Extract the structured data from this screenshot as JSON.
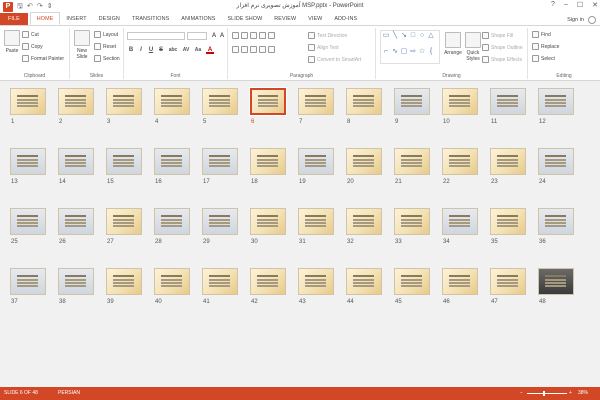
{
  "window": {
    "title": "آموزش تصویری نرم افزار MSP.pptx - PowerPoint",
    "help": "?",
    "min": "–",
    "max": "☐",
    "close": "✕"
  },
  "qat": {
    "app_icon": "P",
    "save": "🖫",
    "undo": "↶",
    "redo": "↷",
    "customize": "⇕"
  },
  "tabs": [
    "FILE",
    "HOME",
    "INSERT",
    "DESIGN",
    "TRANSITIONS",
    "ANIMATIONS",
    "SLIDE SHOW",
    "REVIEW",
    "VIEW",
    "ADD-INS"
  ],
  "active_tab": "HOME",
  "account": {
    "sign_in": "Sign in"
  },
  "ribbon": {
    "clipboard": {
      "label": "Clipboard",
      "paste": "Paste",
      "cut": "Cut",
      "copy": "Copy",
      "format_painter": "Format Painter"
    },
    "slides": {
      "label": "Slides",
      "new_slide": "New Slide",
      "layout": "Layout",
      "reset": "Reset",
      "section": "Section"
    },
    "font": {
      "label": "Font",
      "bold": "B",
      "italic": "I",
      "underline": "U",
      "strike": "S",
      "shadow": "abc",
      "spacing": "AV",
      "case": "Aa",
      "color": "A"
    },
    "paragraph": {
      "label": "Paragraph",
      "text_direction": "Text Direction",
      "align_text": "Align Text",
      "convert_smartart": "Convert to SmartArt"
    },
    "drawing": {
      "label": "Drawing",
      "arrange": "Arrange",
      "quick_styles": "Quick Styles",
      "shape_fill": "Shape Fill",
      "shape_outline": "Shape Outline",
      "shape_effects": "Shape Effects"
    },
    "editing": {
      "label": "Editing",
      "find": "Find",
      "replace": "Replace",
      "select": "Select"
    }
  },
  "slides": [
    {
      "n": "1",
      "kind": "text"
    },
    {
      "n": "2",
      "kind": "text"
    },
    {
      "n": "3",
      "kind": "text"
    },
    {
      "n": "4",
      "kind": "text"
    },
    {
      "n": "5",
      "kind": "text"
    },
    {
      "n": "6",
      "kind": "text"
    },
    {
      "n": "7",
      "kind": "text"
    },
    {
      "n": "8",
      "kind": "text"
    },
    {
      "n": "9",
      "kind": "shot"
    },
    {
      "n": "10",
      "kind": "text"
    },
    {
      "n": "11",
      "kind": "shot"
    },
    {
      "n": "12",
      "kind": "shot"
    },
    {
      "n": "13",
      "kind": "shot"
    },
    {
      "n": "14",
      "kind": "shot"
    },
    {
      "n": "15",
      "kind": "shot"
    },
    {
      "n": "16",
      "kind": "shot"
    },
    {
      "n": "17",
      "kind": "shot"
    },
    {
      "n": "18",
      "kind": "text"
    },
    {
      "n": "19",
      "kind": "shot"
    },
    {
      "n": "20",
      "kind": "text"
    },
    {
      "n": "21",
      "kind": "text"
    },
    {
      "n": "22",
      "kind": "text"
    },
    {
      "n": "23",
      "kind": "text"
    },
    {
      "n": "24",
      "kind": "shot"
    },
    {
      "n": "25",
      "kind": "shot"
    },
    {
      "n": "26",
      "kind": "shot"
    },
    {
      "n": "27",
      "kind": "text"
    },
    {
      "n": "28",
      "kind": "shot"
    },
    {
      "n": "29",
      "kind": "shot"
    },
    {
      "n": "30",
      "kind": "text"
    },
    {
      "n": "31",
      "kind": "text"
    },
    {
      "n": "32",
      "kind": "text"
    },
    {
      "n": "33",
      "kind": "text"
    },
    {
      "n": "34",
      "kind": "shot"
    },
    {
      "n": "35",
      "kind": "text"
    },
    {
      "n": "36",
      "kind": "shot"
    },
    {
      "n": "37",
      "kind": "shot"
    },
    {
      "n": "38",
      "kind": "shot"
    },
    {
      "n": "39",
      "kind": "text"
    },
    {
      "n": "40",
      "kind": "text"
    },
    {
      "n": "41",
      "kind": "text"
    },
    {
      "n": "42",
      "kind": "text"
    },
    {
      "n": "43",
      "kind": "text"
    },
    {
      "n": "44",
      "kind": "text"
    },
    {
      "n": "45",
      "kind": "text"
    },
    {
      "n": "46",
      "kind": "text"
    },
    {
      "n": "47",
      "kind": "text"
    },
    {
      "n": "48",
      "kind": "dark"
    }
  ],
  "selected_slide": "6",
  "status": {
    "slide_info": "SLIDE 6 OF 48",
    "language": "PERSIAN",
    "zoom": "38%",
    "zoom_out": "−",
    "zoom_in": "+"
  },
  "colors": {
    "accent": "#d24726"
  }
}
